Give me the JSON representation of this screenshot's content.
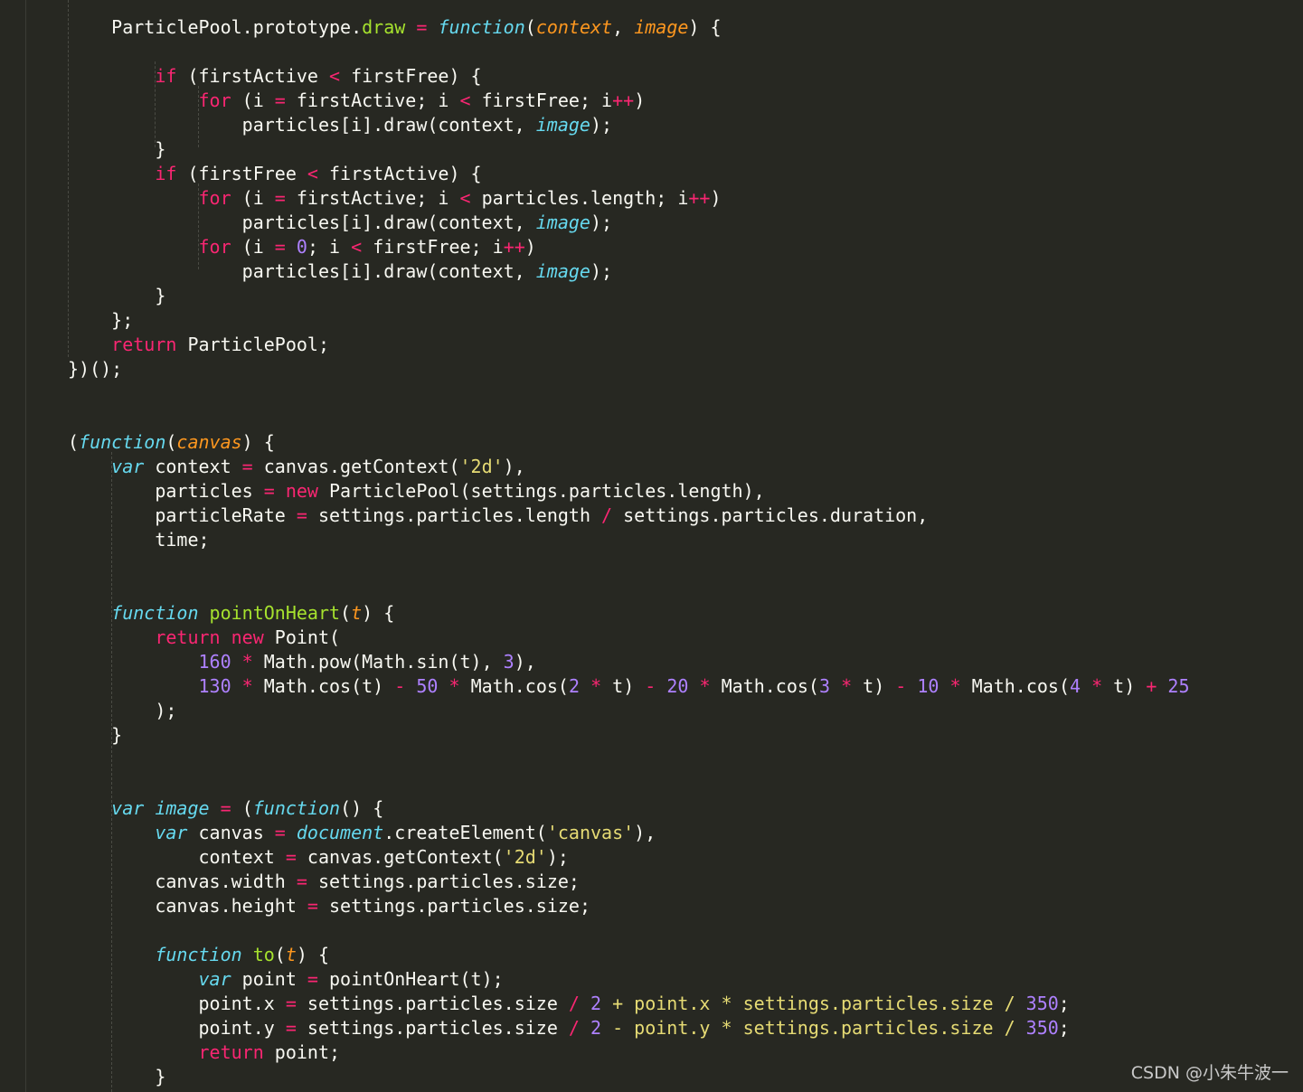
{
  "editor": {
    "theme_colors": {
      "background": "#272822",
      "plain": "#f8f8f2",
      "keyword": "#f92672",
      "storage": "#66d9ef",
      "parameter": "#fd971f",
      "function_name": "#a6e22e",
      "number": "#ae81ff",
      "string": "#e6db74"
    },
    "lines": [
      [
        {
          "t": "    ",
          "k": "plain"
        },
        {
          "t": "ParticlePool",
          "k": "plain"
        },
        {
          "t": ".",
          "k": "plain"
        },
        {
          "t": "prototype",
          "k": "plain"
        },
        {
          "t": ".",
          "k": "plain"
        },
        {
          "t": "draw",
          "k": "prop"
        },
        {
          "t": " = ",
          "k": "op"
        },
        {
          "t": "function",
          "k": "function-kw"
        },
        {
          "t": "(",
          "k": "plain"
        },
        {
          "t": "context",
          "k": "param"
        },
        {
          "t": ", ",
          "k": "plain"
        },
        {
          "t": "image",
          "k": "param"
        },
        {
          "t": ") {",
          "k": "plain"
        }
      ],
      [],
      [
        {
          "t": "        ",
          "k": "plain"
        },
        {
          "t": "if",
          "k": "keyword"
        },
        {
          "t": " (firstActive ",
          "k": "plain"
        },
        {
          "t": "<",
          "k": "op"
        },
        {
          "t": " firstFree) {",
          "k": "plain"
        }
      ],
      [
        {
          "t": "            ",
          "k": "plain"
        },
        {
          "t": "for",
          "k": "keyword"
        },
        {
          "t": " (i ",
          "k": "plain"
        },
        {
          "t": "=",
          "k": "op"
        },
        {
          "t": " firstActive; i ",
          "k": "plain"
        },
        {
          "t": "<",
          "k": "op"
        },
        {
          "t": " firstFree; i",
          "k": "plain"
        },
        {
          "t": "++",
          "k": "op"
        },
        {
          "t": ")",
          "k": "plain"
        }
      ],
      [
        {
          "t": "                ",
          "k": "plain"
        },
        {
          "t": "particles[i].draw(context, ",
          "k": "plain"
        },
        {
          "t": "image",
          "k": "global"
        },
        {
          "t": ");",
          "k": "plain"
        }
      ],
      [
        {
          "t": "        }",
          "k": "plain"
        }
      ],
      [
        {
          "t": "        ",
          "k": "plain"
        },
        {
          "t": "if",
          "k": "keyword"
        },
        {
          "t": " (firstFree ",
          "k": "plain"
        },
        {
          "t": "<",
          "k": "op"
        },
        {
          "t": " firstActive) {",
          "k": "plain"
        }
      ],
      [
        {
          "t": "            ",
          "k": "plain"
        },
        {
          "t": "for",
          "k": "keyword"
        },
        {
          "t": " (i ",
          "k": "plain"
        },
        {
          "t": "=",
          "k": "op"
        },
        {
          "t": " firstActive; i ",
          "k": "plain"
        },
        {
          "t": "<",
          "k": "op"
        },
        {
          "t": " particles.length; i",
          "k": "plain"
        },
        {
          "t": "++",
          "k": "op"
        },
        {
          "t": ")",
          "k": "plain"
        }
      ],
      [
        {
          "t": "                ",
          "k": "plain"
        },
        {
          "t": "particles[i].draw(context, ",
          "k": "plain"
        },
        {
          "t": "image",
          "k": "global"
        },
        {
          "t": ");",
          "k": "plain"
        }
      ],
      [
        {
          "t": "            ",
          "k": "plain"
        },
        {
          "t": "for",
          "k": "keyword"
        },
        {
          "t": " (i ",
          "k": "plain"
        },
        {
          "t": "=",
          "k": "op"
        },
        {
          "t": " ",
          "k": "plain"
        },
        {
          "t": "0",
          "k": "number"
        },
        {
          "t": "; i ",
          "k": "plain"
        },
        {
          "t": "<",
          "k": "op"
        },
        {
          "t": " firstFree; i",
          "k": "plain"
        },
        {
          "t": "++",
          "k": "op"
        },
        {
          "t": ")",
          "k": "plain"
        }
      ],
      [
        {
          "t": "                ",
          "k": "plain"
        },
        {
          "t": "particles[i].draw(context, ",
          "k": "plain"
        },
        {
          "t": "image",
          "k": "global"
        },
        {
          "t": ");",
          "k": "plain"
        }
      ],
      [
        {
          "t": "        }",
          "k": "plain"
        }
      ],
      [
        {
          "t": "    };",
          "k": "plain"
        }
      ],
      [
        {
          "t": "    ",
          "k": "plain"
        },
        {
          "t": "return",
          "k": "keyword"
        },
        {
          "t": " ParticlePool;",
          "k": "plain"
        }
      ],
      [
        {
          "t": "})();",
          "k": "plain"
        }
      ],
      [],
      [],
      [
        {
          "t": "(",
          "k": "plain"
        },
        {
          "t": "function",
          "k": "function-kw"
        },
        {
          "t": "(",
          "k": "plain"
        },
        {
          "t": "canvas",
          "k": "param"
        },
        {
          "t": ") {",
          "k": "plain"
        }
      ],
      [
        {
          "t": "    ",
          "k": "plain"
        },
        {
          "t": "var",
          "k": "storage"
        },
        {
          "t": " context ",
          "k": "plain"
        },
        {
          "t": "=",
          "k": "op"
        },
        {
          "t": " canvas.getContext(",
          "k": "plain"
        },
        {
          "t": "'2d'",
          "k": "string"
        },
        {
          "t": "),",
          "k": "plain"
        }
      ],
      [
        {
          "t": "        particles ",
          "k": "plain"
        },
        {
          "t": "=",
          "k": "op"
        },
        {
          "t": " ",
          "k": "plain"
        },
        {
          "t": "new",
          "k": "keyword"
        },
        {
          "t": " ParticlePool(settings.particles.length),",
          "k": "plain"
        }
      ],
      [
        {
          "t": "        particleRate ",
          "k": "plain"
        },
        {
          "t": "=",
          "k": "op"
        },
        {
          "t": " settings.particles.length ",
          "k": "plain"
        },
        {
          "t": "/",
          "k": "op"
        },
        {
          "t": " settings.particles.duration,",
          "k": "plain"
        }
      ],
      [
        {
          "t": "        time;",
          "k": "plain"
        }
      ],
      [],
      [],
      [
        {
          "t": "    ",
          "k": "plain"
        },
        {
          "t": "function",
          "k": "function-kw"
        },
        {
          "t": " ",
          "k": "plain"
        },
        {
          "t": "pointOnHeart",
          "k": "fn-name"
        },
        {
          "t": "(",
          "k": "plain"
        },
        {
          "t": "t",
          "k": "param"
        },
        {
          "t": ") {",
          "k": "plain"
        }
      ],
      [
        {
          "t": "        ",
          "k": "plain"
        },
        {
          "t": "return",
          "k": "keyword"
        },
        {
          "t": " ",
          "k": "plain"
        },
        {
          "t": "new",
          "k": "keyword"
        },
        {
          "t": " Point(",
          "k": "plain"
        }
      ],
      [
        {
          "t": "            ",
          "k": "plain"
        },
        {
          "t": "160",
          "k": "number"
        },
        {
          "t": " ",
          "k": "plain"
        },
        {
          "t": "*",
          "k": "op"
        },
        {
          "t": " Math.pow(Math.sin(t), ",
          "k": "plain"
        },
        {
          "t": "3",
          "k": "number"
        },
        {
          "t": "),",
          "k": "plain"
        }
      ],
      [
        {
          "t": "            ",
          "k": "plain"
        },
        {
          "t": "130",
          "k": "number"
        },
        {
          "t": " ",
          "k": "plain"
        },
        {
          "t": "*",
          "k": "op"
        },
        {
          "t": " Math.cos(t) ",
          "k": "plain"
        },
        {
          "t": "-",
          "k": "op"
        },
        {
          "t": " ",
          "k": "plain"
        },
        {
          "t": "50",
          "k": "number"
        },
        {
          "t": " ",
          "k": "plain"
        },
        {
          "t": "*",
          "k": "op"
        },
        {
          "t": " Math.cos(",
          "k": "plain"
        },
        {
          "t": "2",
          "k": "number"
        },
        {
          "t": " ",
          "k": "plain"
        },
        {
          "t": "*",
          "k": "op"
        },
        {
          "t": " t) ",
          "k": "plain"
        },
        {
          "t": "-",
          "k": "op"
        },
        {
          "t": " ",
          "k": "plain"
        },
        {
          "t": "20",
          "k": "number"
        },
        {
          "t": " ",
          "k": "plain"
        },
        {
          "t": "*",
          "k": "op"
        },
        {
          "t": " Math.cos(",
          "k": "plain"
        },
        {
          "t": "3",
          "k": "number"
        },
        {
          "t": " ",
          "k": "plain"
        },
        {
          "t": "*",
          "k": "op"
        },
        {
          "t": " t) ",
          "k": "plain"
        },
        {
          "t": "-",
          "k": "op"
        },
        {
          "t": " ",
          "k": "plain"
        },
        {
          "t": "10",
          "k": "number"
        },
        {
          "t": " ",
          "k": "plain"
        },
        {
          "t": "*",
          "k": "op"
        },
        {
          "t": " Math.cos(",
          "k": "plain"
        },
        {
          "t": "4",
          "k": "number"
        },
        {
          "t": " ",
          "k": "plain"
        },
        {
          "t": "*",
          "k": "op"
        },
        {
          "t": " t) ",
          "k": "plain"
        },
        {
          "t": "+",
          "k": "op"
        },
        {
          "t": " ",
          "k": "plain"
        },
        {
          "t": "25",
          "k": "number"
        }
      ],
      [
        {
          "t": "        );",
          "k": "plain"
        }
      ],
      [
        {
          "t": "    }",
          "k": "plain"
        }
      ],
      [],
      [],
      [
        {
          "t": "    ",
          "k": "plain"
        },
        {
          "t": "var",
          "k": "storage"
        },
        {
          "t": " ",
          "k": "plain"
        },
        {
          "t": "image",
          "k": "global"
        },
        {
          "t": " ",
          "k": "plain"
        },
        {
          "t": "=",
          "k": "op"
        },
        {
          "t": " (",
          "k": "plain"
        },
        {
          "t": "function",
          "k": "function-kw"
        },
        {
          "t": "() {",
          "k": "plain"
        }
      ],
      [
        {
          "t": "        ",
          "k": "plain"
        },
        {
          "t": "var",
          "k": "storage"
        },
        {
          "t": " canvas ",
          "k": "plain"
        },
        {
          "t": "=",
          "k": "op"
        },
        {
          "t": " ",
          "k": "plain"
        },
        {
          "t": "document",
          "k": "global"
        },
        {
          "t": ".createElement(",
          "k": "plain"
        },
        {
          "t": "'canvas'",
          "k": "string"
        },
        {
          "t": "),",
          "k": "plain"
        }
      ],
      [
        {
          "t": "            context ",
          "k": "plain"
        },
        {
          "t": "=",
          "k": "op"
        },
        {
          "t": " canvas.getContext(",
          "k": "plain"
        },
        {
          "t": "'2d'",
          "k": "string"
        },
        {
          "t": ");",
          "k": "plain"
        }
      ],
      [
        {
          "t": "        canvas.width ",
          "k": "plain"
        },
        {
          "t": "=",
          "k": "op"
        },
        {
          "t": " settings.particles.size;",
          "k": "plain"
        }
      ],
      [
        {
          "t": "        canvas.height ",
          "k": "plain"
        },
        {
          "t": "=",
          "k": "op"
        },
        {
          "t": " settings.particles.size;",
          "k": "plain"
        }
      ],
      [],
      [
        {
          "t": "        ",
          "k": "plain"
        },
        {
          "t": "function",
          "k": "function-kw"
        },
        {
          "t": " ",
          "k": "plain"
        },
        {
          "t": "to",
          "k": "fn-name"
        },
        {
          "t": "(",
          "k": "plain"
        },
        {
          "t": "t",
          "k": "param"
        },
        {
          "t": ") {",
          "k": "plain"
        }
      ],
      [
        {
          "t": "            ",
          "k": "plain"
        },
        {
          "t": "var",
          "k": "storage"
        },
        {
          "t": " point ",
          "k": "plain"
        },
        {
          "t": "=",
          "k": "op"
        },
        {
          "t": " pointOnHeart(t);",
          "k": "plain"
        }
      ],
      [
        {
          "t": "            point.x ",
          "k": "plain"
        },
        {
          "t": "=",
          "k": "op"
        },
        {
          "t": " settings.particles.size ",
          "k": "plain"
        },
        {
          "t": "/",
          "k": "op"
        },
        {
          "t": " ",
          "k": "plain"
        },
        {
          "t": "2",
          "k": "number"
        },
        {
          "t": " ",
          "k": "plain"
        },
        {
          "t": "+ point.x * settings.particles.size /",
          "k": "string"
        },
        {
          "t": " ",
          "k": "plain"
        },
        {
          "t": "350",
          "k": "number"
        },
        {
          "t": ";",
          "k": "plain"
        }
      ],
      [
        {
          "t": "            point.y ",
          "k": "plain"
        },
        {
          "t": "=",
          "k": "op"
        },
        {
          "t": " settings.particles.size ",
          "k": "plain"
        },
        {
          "t": "/",
          "k": "op"
        },
        {
          "t": " ",
          "k": "plain"
        },
        {
          "t": "2",
          "k": "number"
        },
        {
          "t": " ",
          "k": "plain"
        },
        {
          "t": "- point.y * settings.particles.size /",
          "k": "string"
        },
        {
          "t": " ",
          "k": "plain"
        },
        {
          "t": "350",
          "k": "number"
        },
        {
          "t": ";",
          "k": "plain"
        }
      ],
      [
        {
          "t": "            ",
          "k": "plain"
        },
        {
          "t": "return",
          "k": "keyword"
        },
        {
          "t": " point;",
          "k": "plain"
        }
      ],
      [
        {
          "t": "        }",
          "k": "plain"
        }
      ]
    ]
  },
  "watermark": {
    "text": "CSDN @小朱牛波一"
  }
}
